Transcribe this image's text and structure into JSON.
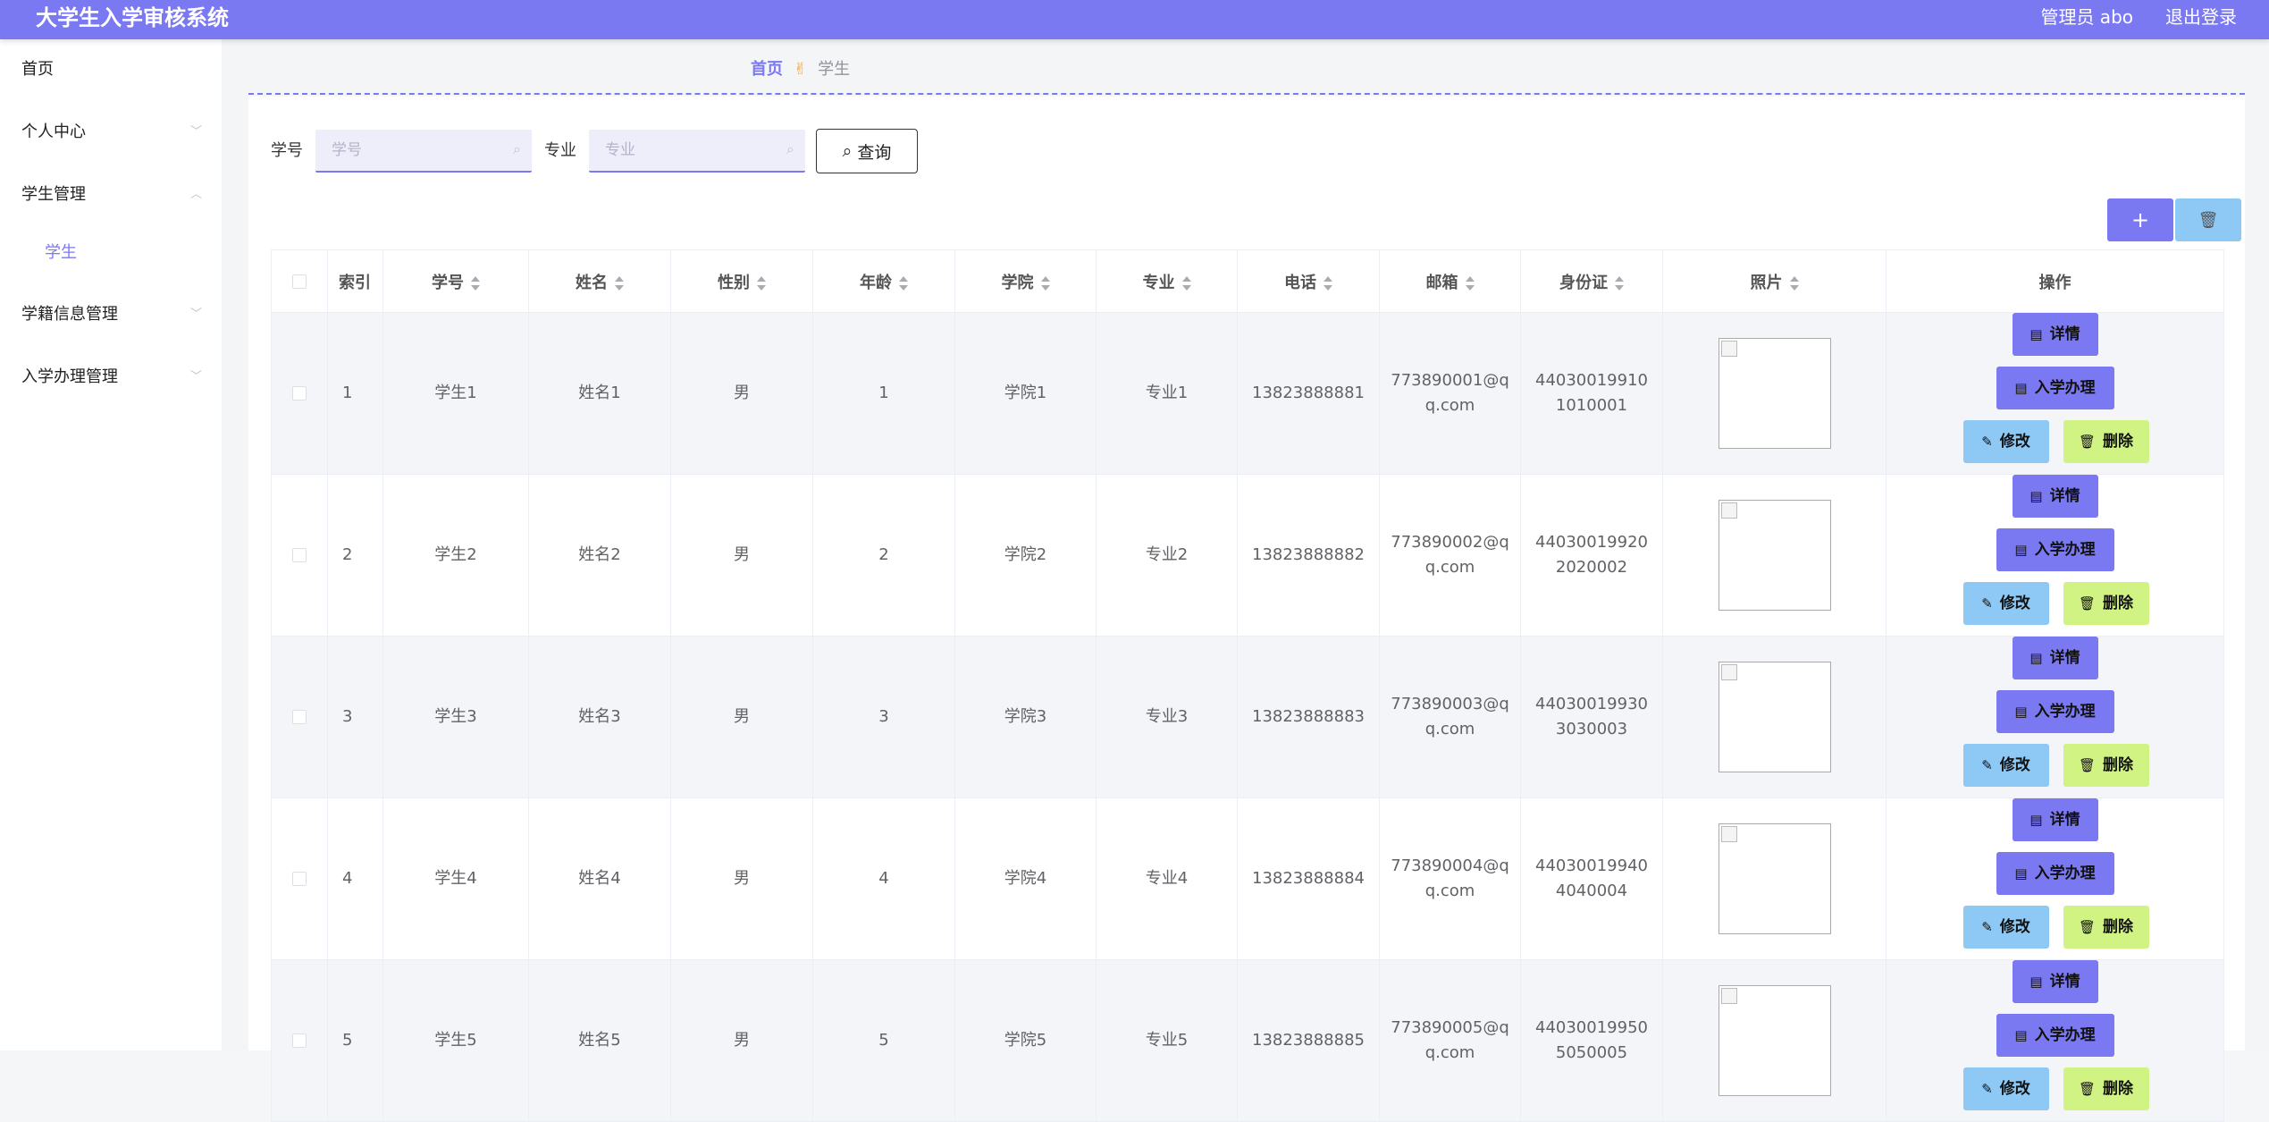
{
  "header": {
    "title": "大学生入学审核系统",
    "user": "管理员 abo",
    "logout": "退出登录"
  },
  "sidebar": {
    "items": [
      {
        "label": "首页"
      },
      {
        "label": "个人中心"
      },
      {
        "label": "学生管理"
      },
      {
        "label": "学生"
      },
      {
        "label": "学籍信息管理"
      },
      {
        "label": "入学办理管理"
      }
    ]
  },
  "breadcrumb": {
    "home": "首页",
    "separator": "✌",
    "current": "学生"
  },
  "search": {
    "student_no_label": "学号",
    "student_no_placeholder": "学号",
    "major_label": "专业",
    "major_placeholder": "专业",
    "query_label": "查询"
  },
  "toolbar": {
    "add_label": "+",
    "delete_icon": "trash-icon"
  },
  "table": {
    "columns": [
      "索引",
      "学号",
      "姓名",
      "性别",
      "年龄",
      "学院",
      "专业",
      "电话",
      "邮箱",
      "身份证",
      "照片",
      "操作"
    ],
    "rows": [
      {
        "index": "1",
        "student_no": "学生1",
        "name": "姓名1",
        "gender": "男",
        "age": "1",
        "college": "学院1",
        "major": "专业1",
        "phone": "13823888881",
        "email": "773890001@qq.com",
        "id_card": "440300199101010001"
      },
      {
        "index": "2",
        "student_no": "学生2",
        "name": "姓名2",
        "gender": "男",
        "age": "2",
        "college": "学院2",
        "major": "专业2",
        "phone": "13823888882",
        "email": "773890002@qq.com",
        "id_card": "440300199202020002"
      },
      {
        "index": "3",
        "student_no": "学生3",
        "name": "姓名3",
        "gender": "男",
        "age": "3",
        "college": "学院3",
        "major": "专业3",
        "phone": "13823888883",
        "email": "773890003@qq.com",
        "id_card": "440300199303030003"
      },
      {
        "index": "4",
        "student_no": "学生4",
        "name": "姓名4",
        "gender": "男",
        "age": "4",
        "college": "学院4",
        "major": "专业4",
        "phone": "13823888884",
        "email": "773890004@qq.com",
        "id_card": "440300199404040004"
      },
      {
        "index": "5",
        "student_no": "学生5",
        "name": "姓名5",
        "gender": "男",
        "age": "5",
        "college": "学院5",
        "major": "专业5",
        "phone": "13823888885",
        "email": "773890005@qq.com",
        "id_card": "440300199505050005"
      }
    ],
    "actions": {
      "detail": "详情",
      "enroll": "入学办理",
      "edit": "修改",
      "delete": "删除"
    }
  },
  "colors": {
    "primary": "#7b79f1",
    "info": "#8ec8f4",
    "warn": "#d1f383"
  }
}
